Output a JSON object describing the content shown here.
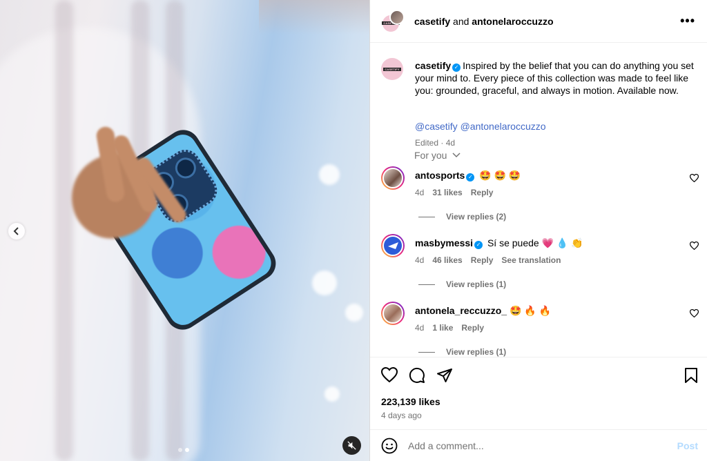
{
  "header": {
    "author": "casetify",
    "joiner": "and",
    "coauthor": "antonelaroccuzzo",
    "more_label": "•••"
  },
  "caption": {
    "username": "casetify",
    "text": "Inspired by the belief that you can do anything you set your mind to. Every piece of this collection was made to feel like you: grounded, graceful, and always in motion. Available now.",
    "mention1": "@casetify",
    "mention2": "@antonelaroccuzzo",
    "meta": "Edited · 4d",
    "logo_text": "CASETiFY"
  },
  "sort_label": "For you",
  "comments": [
    {
      "username": "antosports",
      "text": "🤩 🤩 🤩",
      "time": "4d",
      "likes": "31 likes",
      "reply": "Reply",
      "view_replies": "View replies (2)",
      "verified": true
    },
    {
      "username": "masbymessi",
      "text": "Sí se puede 💗 💧 👏",
      "time": "4d",
      "likes": "46 likes",
      "reply": "Reply",
      "translation": "See translation",
      "view_replies": "View replies (1)",
      "verified": true
    },
    {
      "username": "antonela_reccuzzo_",
      "text": "🤩 🔥 🔥",
      "time": "4d",
      "likes": "1 like",
      "reply": "Reply",
      "view_replies": "View replies (1)",
      "verified": false
    }
  ],
  "stats": {
    "likes": "223,139 likes",
    "time_ago": "4 days ago"
  },
  "comment_box": {
    "placeholder": "Add a comment...",
    "post_label": "Post"
  },
  "media": {
    "prev_icon": "chevron-left-icon",
    "mute_icon": "speaker-muted-icon",
    "carousel_index": 2,
    "carousel_total": 2
  },
  "colors": {
    "link": "#4169c7",
    "verified": "#0095f6",
    "muted_text": "#737373",
    "post_disabled": "#b3dbff"
  }
}
